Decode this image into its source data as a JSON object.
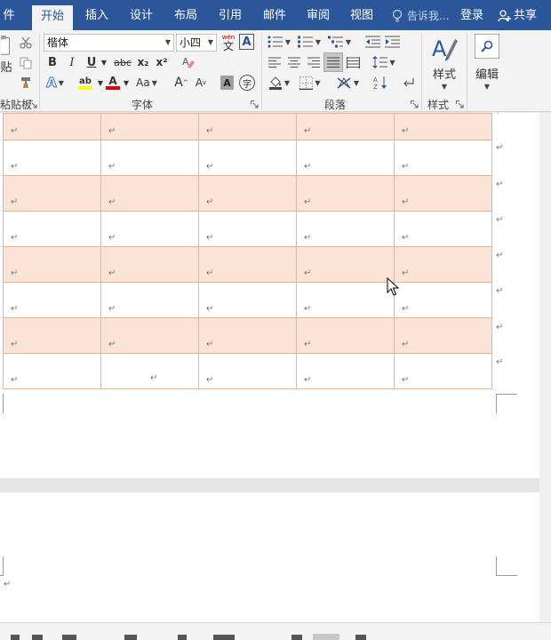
{
  "tabs": [
    {
      "label": "件",
      "active": false
    },
    {
      "label": "开始",
      "active": true
    },
    {
      "label": "插入",
      "active": false
    },
    {
      "label": "设计",
      "active": false
    },
    {
      "label": "布局",
      "active": false
    },
    {
      "label": "引用",
      "active": false
    },
    {
      "label": "邮件",
      "active": false
    },
    {
      "label": "审阅",
      "active": false
    },
    {
      "label": "视图",
      "active": false
    }
  ],
  "tellme": {
    "label": "告诉我..."
  },
  "signin": {
    "label": "登录"
  },
  "share": {
    "label": "共享"
  },
  "clipboard": {
    "paste_label": "贴",
    "group_label": "粘贴板"
  },
  "font": {
    "name": "楷体",
    "size": "小四",
    "phonetic_top": "wén",
    "phonetic_char": "文",
    "border_char": "A",
    "bold": "B",
    "italic": "I",
    "underline": "U",
    "strike": "abc",
    "subscript": "x₂",
    "superscript": "x²",
    "text_effect": "A",
    "highlight": "ab",
    "font_color": "A",
    "change_case": "Aa",
    "grow": "A",
    "shrink": "A",
    "char_shading": "A",
    "enclose": "字",
    "group_label": "字体",
    "highlight_color": "#ffff00",
    "font_color_value": "#e00000"
  },
  "paragraph": {
    "group_label": "段落"
  },
  "styles": {
    "button_label": "样式",
    "group_label": "样式"
  },
  "editing": {
    "button_label": "编辑"
  },
  "marks": {
    "paragraph_mark": "↵"
  },
  "colors": {
    "title_bar": "#2b579a",
    "table_border": "#f0b088",
    "row_shading": "#fbe4d5"
  }
}
